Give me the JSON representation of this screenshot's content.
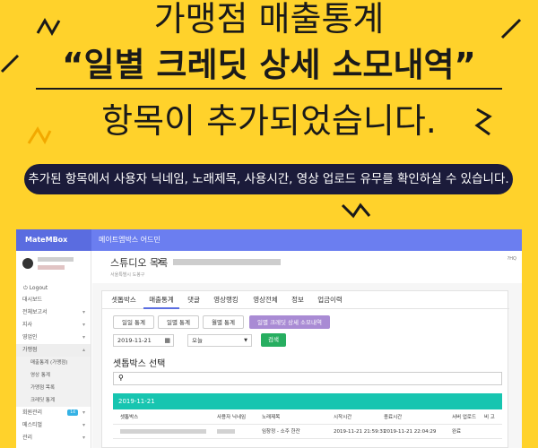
{
  "headline": {
    "line1": "가맹점 매출통계",
    "line2": "“일별 크레딧 상세 소모내역”",
    "line3": "항목이 추가되었습니다."
  },
  "notice": "추가된 항목에서 사용자 닉네임, 노래제목, 사용시간, 영상 업로드 유무를 확인하실 수 있습니다.",
  "app": {
    "brand": "MateMBox",
    "title": "메이트엠박스 어드민",
    "sidebar": {
      "logout": "Logout",
      "items": [
        {
          "label": "대시보드",
          "caret": ""
        },
        {
          "label": "전체보고서",
          "caret": "▾"
        },
        {
          "label": "지사",
          "caret": "▾"
        },
        {
          "label": "영업인",
          "caret": "▾"
        },
        {
          "label": "가맹점",
          "caret": "▴"
        }
      ],
      "sub_items": [
        "매출통계 (가맹점)",
        "영상 통계",
        "가맹점 목록",
        "크레딧 통계"
      ],
      "bottom_items": [
        {
          "label": "회원관리",
          "caret": "▾",
          "badge": "14"
        },
        {
          "label": "메스티벌",
          "caret": "▾",
          "badge": ""
        },
        {
          "label": "관리",
          "caret": "▾",
          "badge": ""
        }
      ]
    },
    "breadcrumb": {
      "title": "스튜디오 목록",
      "sub": "서울특별시 도봉구",
      "right": "?HQ"
    },
    "tabs": [
      "셋톱박스",
      "매출통계",
      "댓글",
      "영상랭킹",
      "영상전체",
      "정보",
      "업금이력"
    ],
    "sub_tabs": [
      "일일 통계",
      "일별 통계",
      "월별 통계",
      "일별 크레딧 상세 소모내역"
    ],
    "filter": {
      "date": "2019-11-21",
      "select": "오늘",
      "search_label": "검색"
    },
    "section_title": "셋톱박스 선택",
    "date_band": "2019-11-21",
    "table": {
      "headers": [
        "셋톱박스",
        "사용자 닉네임",
        "노래제목",
        "시작시간",
        "종료시간",
        "서버 업로드",
        "비 고"
      ],
      "rows": [
        {
          "title": "임창정 - 소주 한잔",
          "start": "2019-11-21 21:59:31",
          "end": "2019-11-21 22:04:29",
          "upload": "완료",
          "note": ""
        }
      ]
    }
  },
  "colors": {
    "background": "#FFD22B",
    "pill": "#1b1b3a",
    "topbar": "#6b7ef0",
    "active_subtab": "#a98bd4",
    "search_button": "#27ae60",
    "date_band": "#17c5b0"
  }
}
